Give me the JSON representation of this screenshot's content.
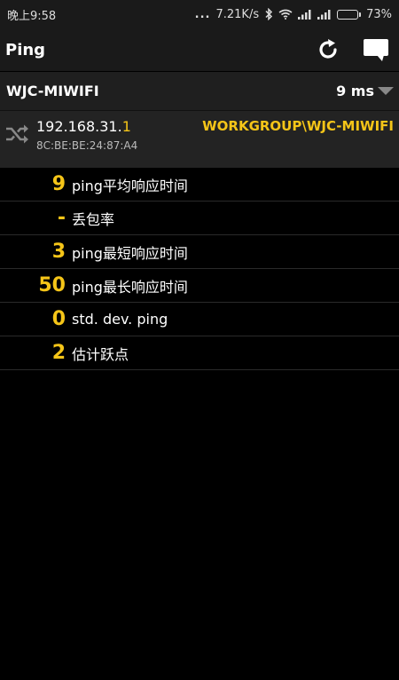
{
  "status_bar": {
    "time": "晚上9:58",
    "dots": "...",
    "network_speed": "7.21K/s",
    "battery_percent": "73%",
    "battery_level": 0.73,
    "icons": [
      "bluetooth-icon",
      "wifi-icon",
      "signal-icon",
      "signal-icon",
      "battery-icon"
    ]
  },
  "app_bar": {
    "title": "Ping",
    "actions": [
      "refresh-icon",
      "comment-icon"
    ]
  },
  "host": {
    "name": "WJC-MIWIFI",
    "latency": "9 ms",
    "ip_prefix": "192.168.31.",
    "ip_suffix": "1",
    "mac": "8C:BE:BE:24:87:A4",
    "group": "WORKGROUP\\WJC-MIWIFI",
    "icon": "shuffle-icon"
  },
  "stats": [
    {
      "value": "9",
      "label": "ping平均响应时间"
    },
    {
      "value": "-",
      "label": "丢包率"
    },
    {
      "value": "3",
      "label": "ping最短响应时间"
    },
    {
      "value": "50",
      "label": "ping最长响应时间"
    },
    {
      "value": "0",
      "label": "std. dev. ping"
    },
    {
      "value": "2",
      "label": "估计跃点"
    }
  ],
  "colors": {
    "accent": "#f5c518",
    "background": "#000000",
    "bar": "#1a1a1a"
  }
}
